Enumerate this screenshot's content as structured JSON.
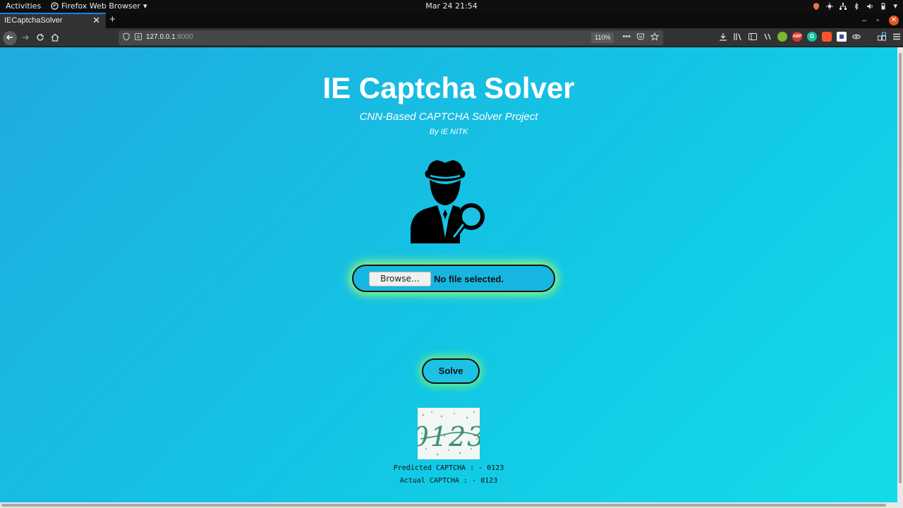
{
  "topbar": {
    "activities": "Activities",
    "app_name": "Firefox Web Browser",
    "clock": "Mar 24  21:54"
  },
  "tab": {
    "title": "IECaptchaSolver",
    "close_glyph": "✕",
    "new_tab_glyph": "+"
  },
  "window_controls": {
    "minimize": "–",
    "restore": "▫",
    "close": "✕"
  },
  "navbar": {
    "url_host": "127.0.0.1",
    "url_port": ":8000",
    "zoom": "110%",
    "more_glyph": "•••"
  },
  "page": {
    "title": "IE Captcha Solver",
    "subtitle": "CNN-Based CAPTCHA Solver Project",
    "byline": "By IE NITK",
    "browse_label": "Browse…",
    "file_status": "No file selected.",
    "solve_label": "Solve",
    "captcha_text": "0123",
    "predicted": "Predicted CAPTCHA : - 0123",
    "actual": "Actual CAPTCHA : - 0123"
  },
  "colors": {
    "accent_tab": "#0a84ff",
    "page_gradient_start": "#20abde",
    "page_gradient_end": "#14dbe8",
    "glow": "#a8ff6a",
    "ubuntu_orange": "#e95420"
  },
  "toolbar_badges": {
    "adblock": "ABP",
    "grammarly": "G"
  }
}
